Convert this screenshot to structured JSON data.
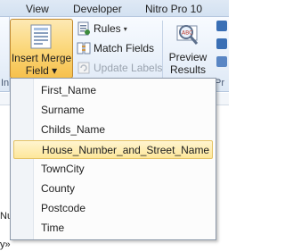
{
  "tabs": [
    "View",
    "Developer",
    "Nitro Pro 10"
  ],
  "ribbon": {
    "insert_merge_field": {
      "line1": "Insert Merge",
      "line2": "Field",
      "caret": "▾"
    },
    "rules": {
      "label": "Rules",
      "caret": "▾"
    },
    "match_fields": {
      "label": "Match Fields"
    },
    "update_labels": {
      "label": "Update Labels"
    },
    "preview_results": {
      "line1": "Preview",
      "line2": "Results"
    },
    "group_label_fragment": "In",
    "right_group_fragment": "Pr"
  },
  "menu": {
    "items": [
      "First_Name",
      "Surname",
      "Childs_Name",
      "House_Number_and_Street_Name",
      "TownCity",
      "County",
      "Postcode",
      "Time"
    ],
    "selected_index": 3
  },
  "document": {
    "fragment1": "Nu",
    "fragment2": "y»"
  },
  "colors": {
    "active_button": "#fbd77a",
    "selected_item": "#fde79a",
    "ribbon_bg": "#eaf1fa"
  }
}
